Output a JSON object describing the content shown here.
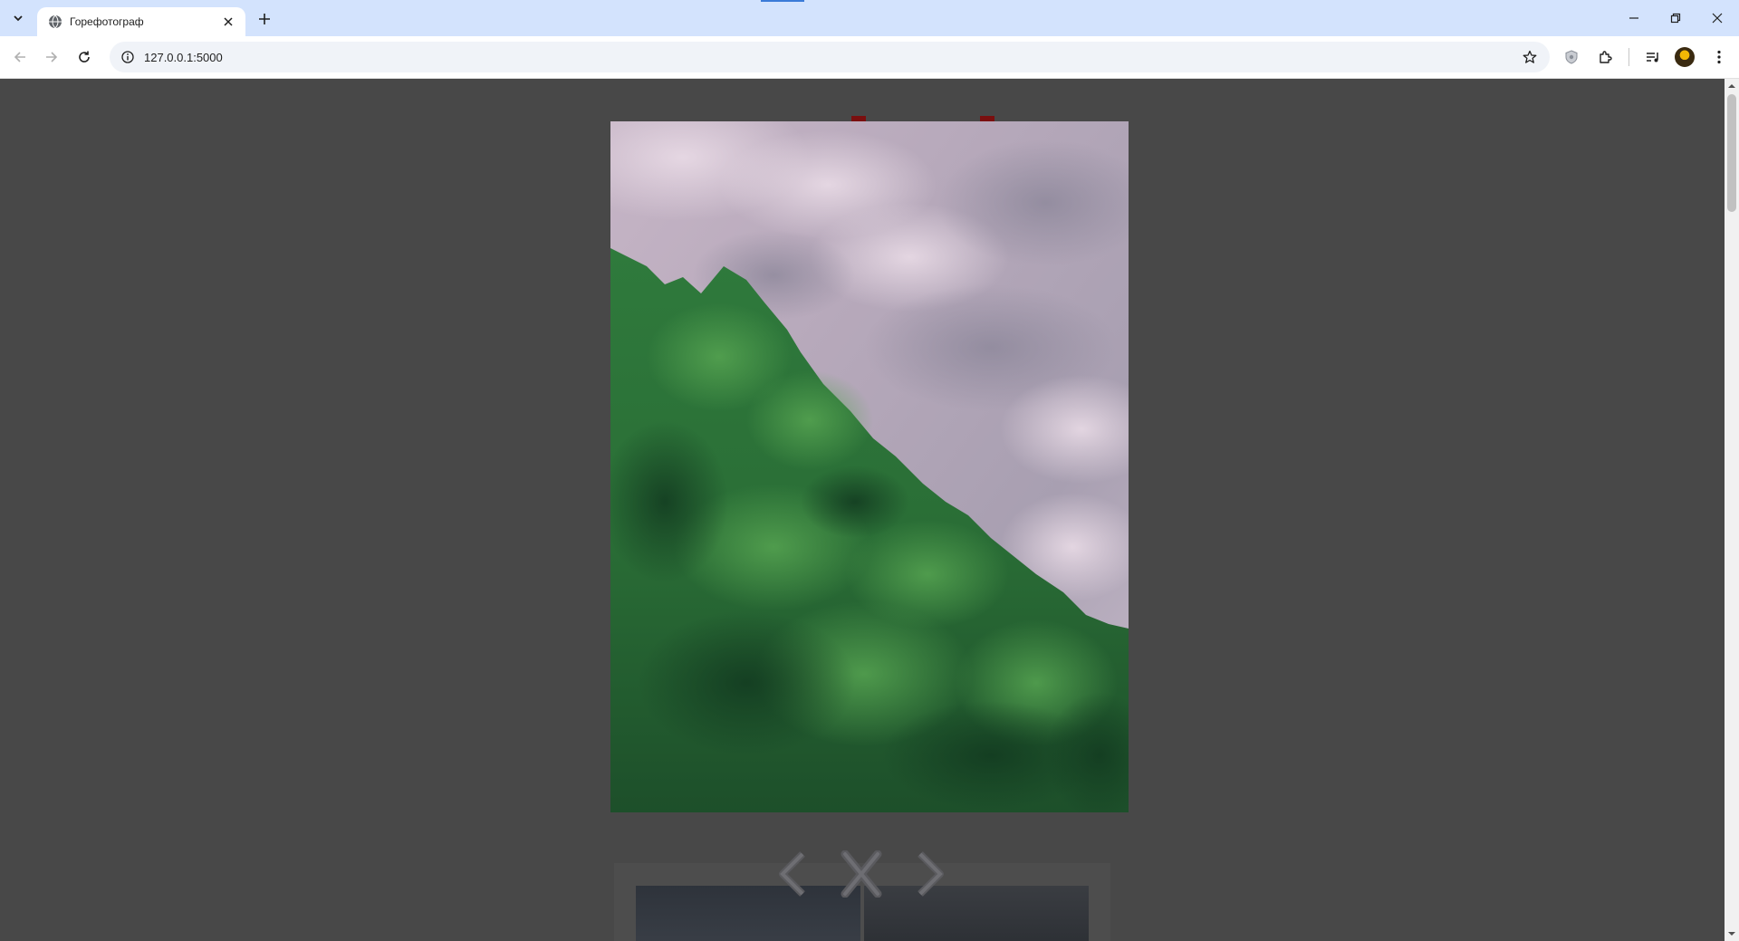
{
  "browser": {
    "tab_title": "Горефотограф",
    "url": "127.0.0.1:5000",
    "icons": [
      "tab-search-icon",
      "globe-icon",
      "close-icon",
      "plus-icon",
      "minimize-icon",
      "restore-icon",
      "close-window-icon",
      "back-icon",
      "forward-icon",
      "reload-icon",
      "site-info-icon",
      "bookmark-star-icon",
      "shield-extension-icon",
      "extensions-puzzle-icon",
      "media-controls-icon",
      "avatar",
      "kebab-menu-icon"
    ]
  },
  "lightbox": {
    "image": "tree-canopy-under-cloudy-sky",
    "buttons": [
      "prev-chevron-icon",
      "close-x-icon",
      "next-chevron-icon"
    ]
  },
  "colors": {
    "tabstrip": "#d3e3fd",
    "page_background": "#484848",
    "gallery_panel": "#4d4d4d",
    "title_marks": "#7a0f0f"
  }
}
